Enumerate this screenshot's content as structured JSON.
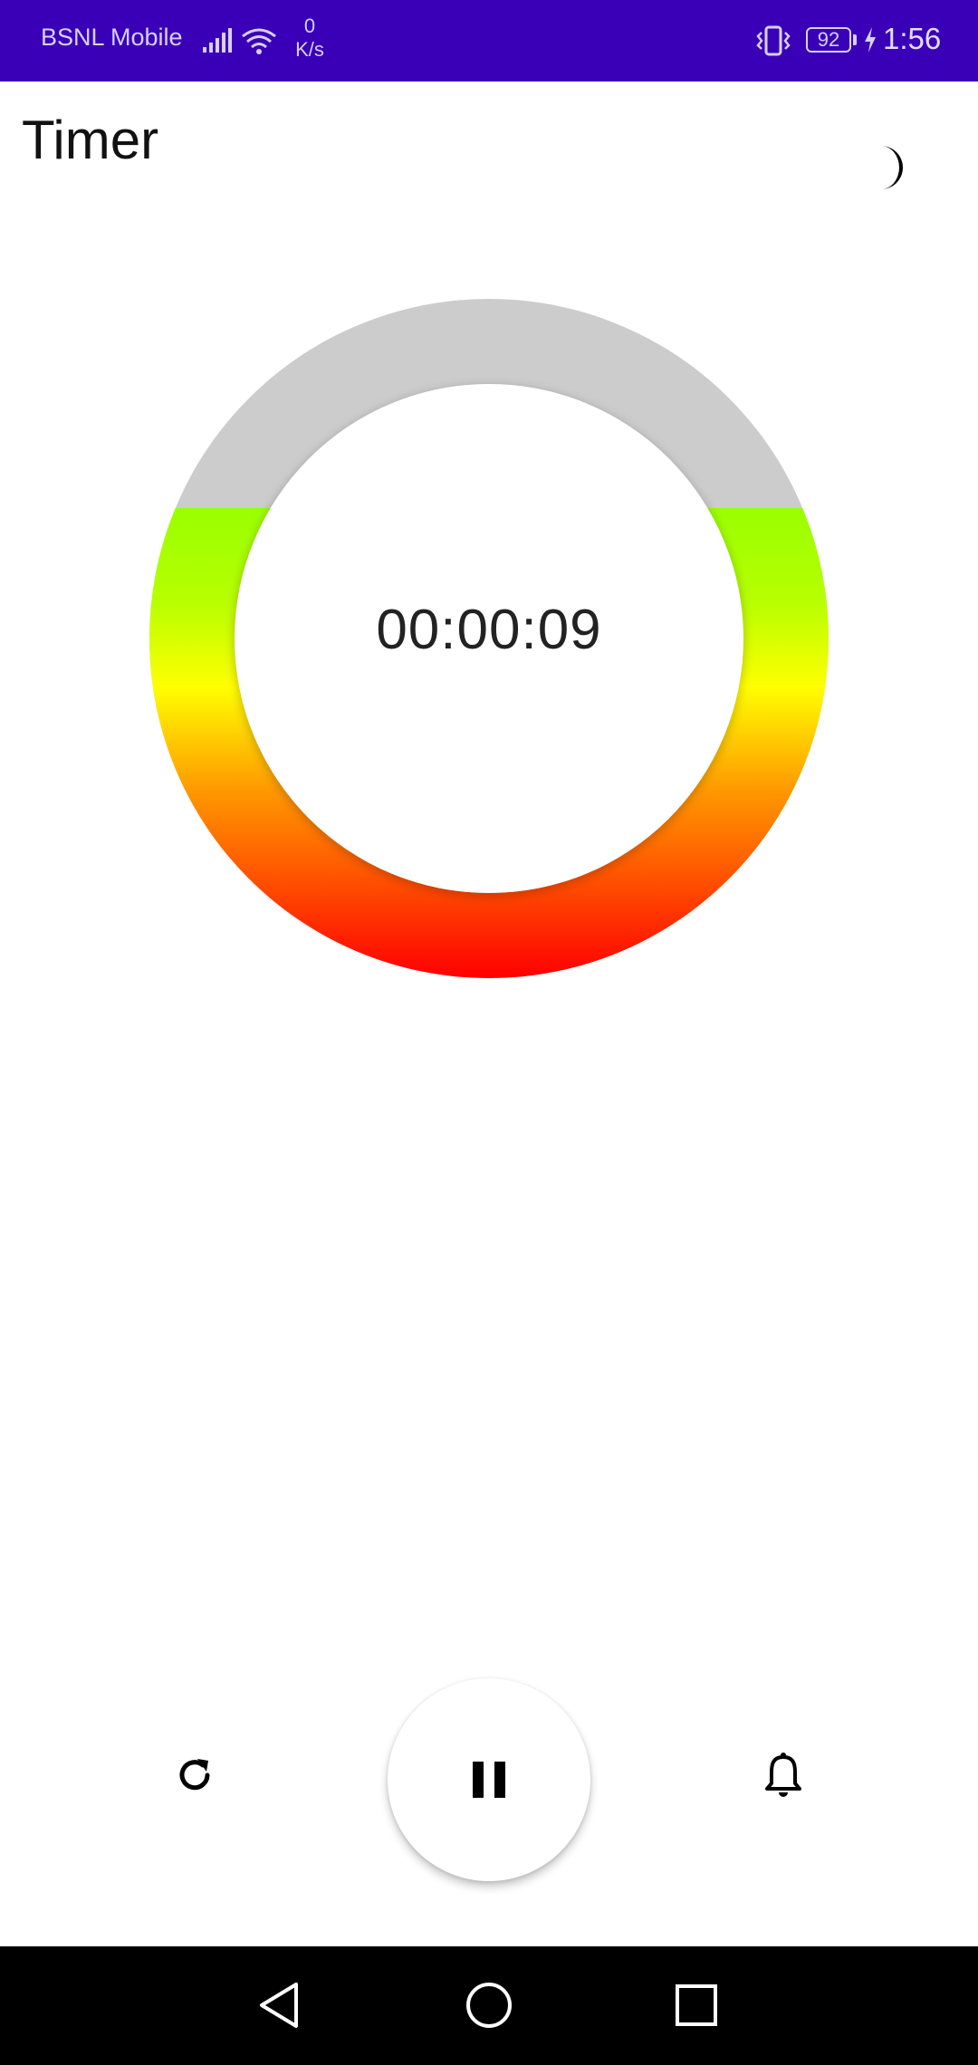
{
  "status_bar": {
    "carrier": "BSNL Mobile",
    "net_speed_value": "0",
    "net_speed_unit": "K/s",
    "battery_level": "92",
    "time": "1:56",
    "background_color": "#3a00b8",
    "icons": [
      "signal-icon",
      "wifi-icon",
      "vibrate-icon",
      "battery-icon",
      "charging-icon"
    ]
  },
  "header": {
    "title": "Timer",
    "theme_toggle_icon": "moon-icon"
  },
  "timer": {
    "display": "00:00:09",
    "ring_track_color": "#cccccc",
    "ring_gradient_colors": [
      "#99ff00",
      "#ffff00",
      "#ff9900",
      "#ff0000"
    ]
  },
  "controls": {
    "reset_icon": "refresh-icon",
    "play_pause_icon": "pause-icon",
    "alarm_icon": "bell-icon"
  },
  "nav_bar": {
    "icons": [
      "back-icon",
      "home-icon",
      "recents-icon"
    ]
  }
}
